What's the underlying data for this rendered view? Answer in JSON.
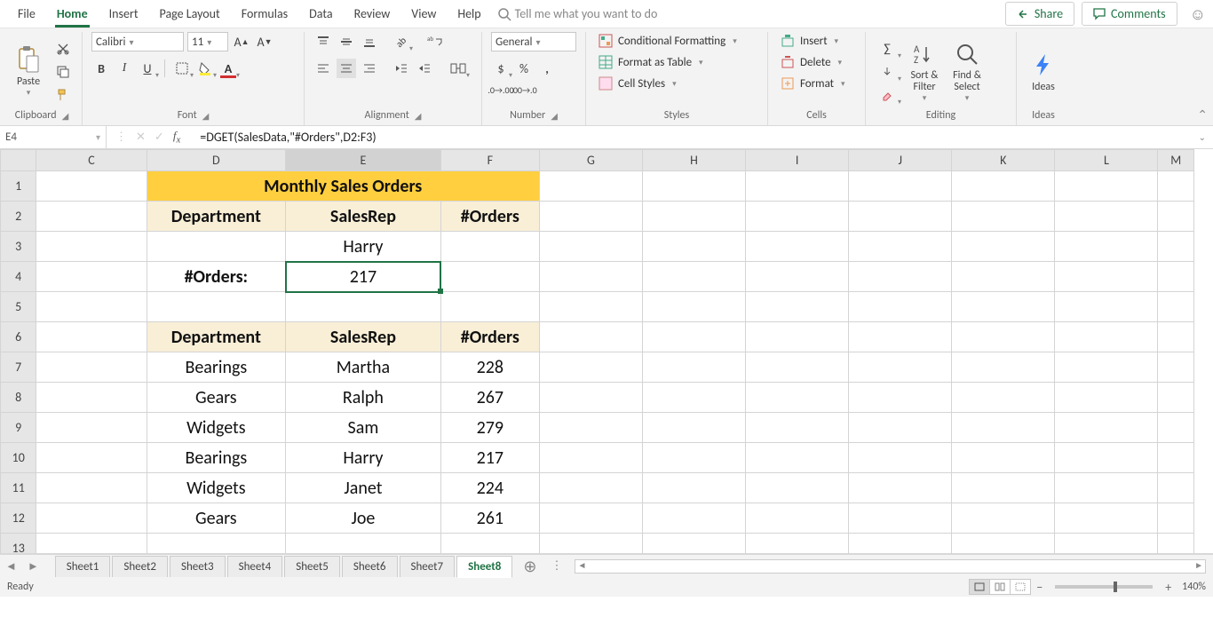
{
  "menu": {
    "items": [
      "File",
      "Home",
      "Insert",
      "Page Layout",
      "Formulas",
      "Data",
      "Review",
      "View",
      "Help"
    ],
    "active": 1,
    "tellme": "Tell me what you want to do",
    "share": "Share",
    "comments": "Comments"
  },
  "ribbon": {
    "clipboard": {
      "label": "Clipboard",
      "paste": "Paste"
    },
    "font": {
      "label": "Font",
      "name": "Calibri",
      "size": "11"
    },
    "alignment": {
      "label": "Alignment"
    },
    "number": {
      "label": "Number",
      "format": "General"
    },
    "styles": {
      "label": "Styles",
      "cond": "Conditional Formatting",
      "table": "Format as Table",
      "cell": "Cell Styles"
    },
    "cells": {
      "label": "Cells",
      "insert": "Insert",
      "delete": "Delete",
      "format": "Format"
    },
    "editing": {
      "label": "Editing",
      "sort": "Sort &\nFilter",
      "find": "Find &\nSelect"
    },
    "ideas": {
      "label": "Ideas",
      "btn": "Ideas"
    }
  },
  "fx": {
    "namebox": "E4",
    "formula": "=DGET(SalesData,\"#Orders\",D2:F3)"
  },
  "sheet": {
    "columns": [
      "C",
      "D",
      "E",
      "F",
      "G",
      "H",
      "I",
      "J",
      "K",
      "L",
      "M"
    ],
    "rows": [
      1,
      2,
      3,
      4,
      5,
      6,
      7,
      8,
      9,
      10,
      11,
      12
    ],
    "selected_row": 4,
    "selected_col": "E",
    "cells": {
      "D1": "Monthly Sales Orders",
      "D2": "Department",
      "E2": "SalesRep",
      "F2": "#Orders",
      "E3": "Harry",
      "D4": "#Orders:",
      "E4": "217",
      "D6": "Department",
      "E6": "SalesRep",
      "F6": "#Orders",
      "D7": "Bearings",
      "E7": "Martha",
      "F7": "228",
      "D8": "Gears",
      "E8": "Ralph",
      "F8": "267",
      "D9": "Widgets",
      "E9": "Sam",
      "F9": "279",
      "D10": "Bearings",
      "E10": "Harry",
      "F10": "217",
      "D11": "Widgets",
      "E11": "Janet",
      "F11": "224",
      "D12": "Gears",
      "E12": "Joe",
      "F12": "261"
    }
  },
  "tabs": {
    "items": [
      "Sheet1",
      "Sheet2",
      "Sheet3",
      "Sheet4",
      "Sheet5",
      "Sheet6",
      "Sheet7",
      "Sheet8"
    ],
    "active": 7
  },
  "status": {
    "ready": "Ready",
    "zoom": "140%"
  }
}
